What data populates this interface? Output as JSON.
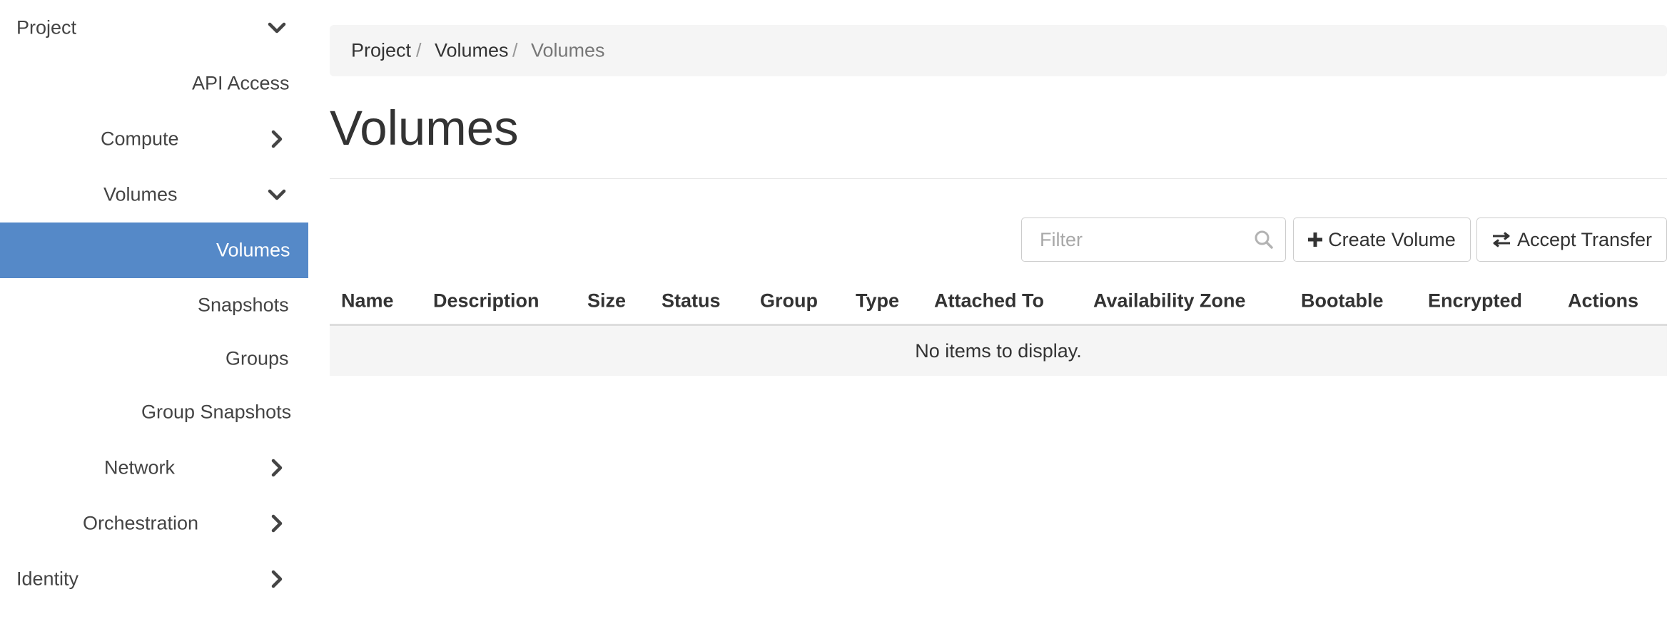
{
  "sidebar": {
    "items": [
      {
        "label": "Project",
        "expanded": true
      },
      {
        "label": "API Access"
      },
      {
        "label": "Compute",
        "expanded": false
      },
      {
        "label": "Volumes",
        "expanded": true
      },
      {
        "label": "Volumes",
        "active": true
      },
      {
        "label": "Snapshots"
      },
      {
        "label": "Groups"
      },
      {
        "label": "Group Snapshots"
      },
      {
        "label": "Network",
        "expanded": false
      },
      {
        "label": "Orchestration",
        "expanded": false
      },
      {
        "label": "Identity",
        "expanded": false
      }
    ]
  },
  "breadcrumb": {
    "items": [
      "Project",
      "Volumes",
      "Volumes"
    ],
    "separator": "/"
  },
  "page": {
    "title": "Volumes"
  },
  "toolbar": {
    "filter_placeholder": "Filter",
    "create_label": "Create Volume",
    "accept_label": "Accept Transfer"
  },
  "table": {
    "columns": [
      "Name",
      "Description",
      "Size",
      "Status",
      "Group",
      "Type",
      "Attached To",
      "Availability Zone",
      "Bootable",
      "Encrypted",
      "Actions"
    ],
    "empty_message": "No items to display."
  },
  "colors": {
    "accent": "#5589c8",
    "breadcrumb_bg": "#f5f5f5",
    "text": "#333333"
  },
  "icons": {
    "expanded": "chevron-down-icon",
    "collapsed": "chevron-right-icon",
    "filter": "search-icon",
    "create": "plus-icon",
    "accept": "exchange-icon"
  }
}
